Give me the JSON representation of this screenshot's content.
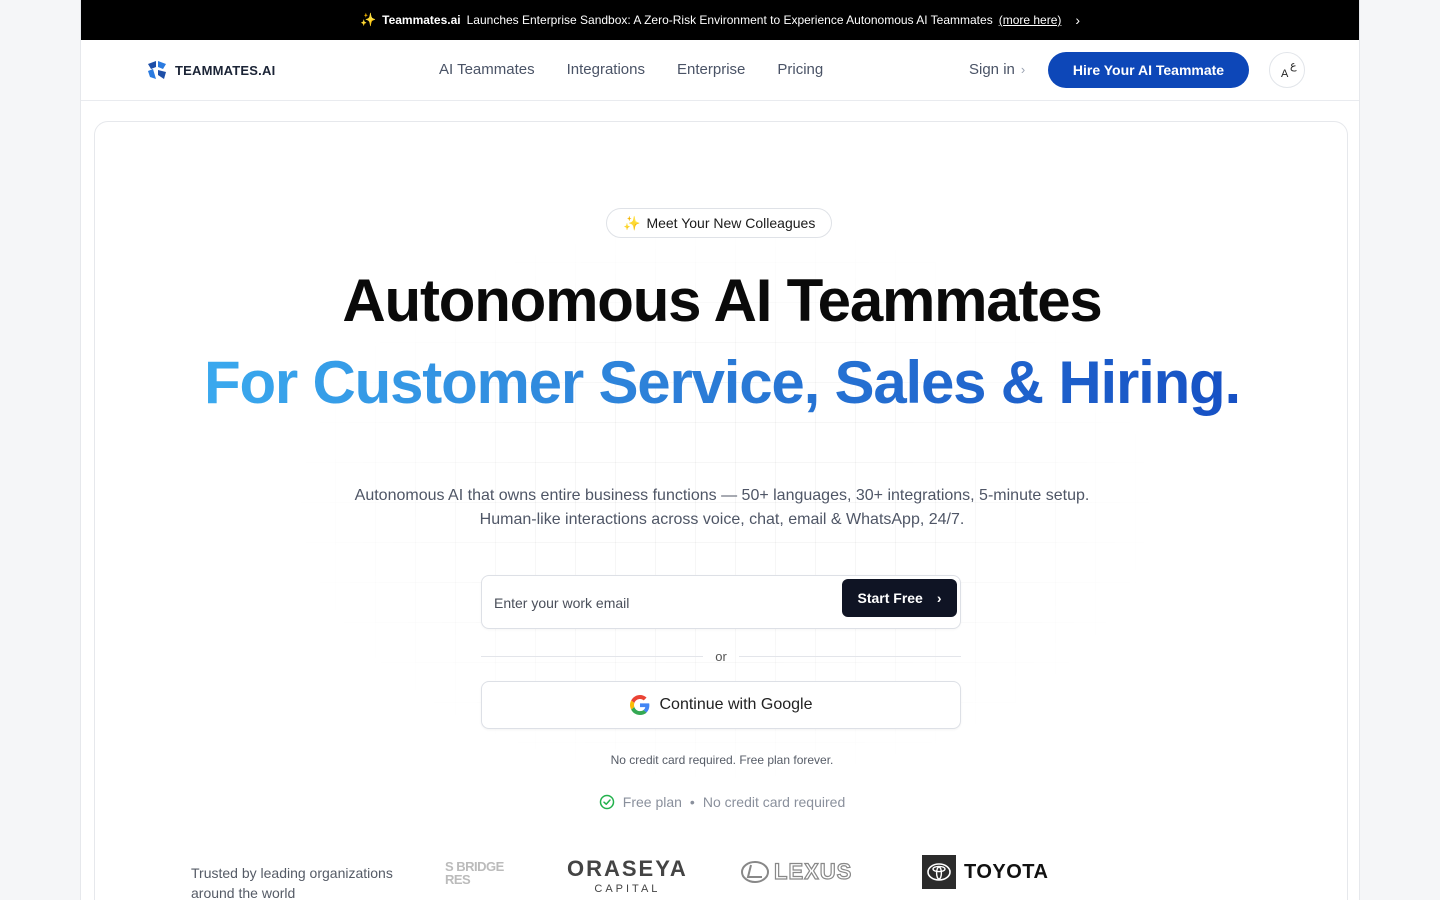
{
  "announcement": {
    "brand": "Teammates.ai",
    "text": "Launches Enterprise Sandbox: A Zero-Risk Environment to Experience Autonomous AI Teammates",
    "link": "(more here)"
  },
  "nav": {
    "logo_text": "TEAMMATES.AI",
    "links": [
      "AI Teammates",
      "Integrations",
      "Enterprise",
      "Pricing"
    ],
    "signin": "Sign in",
    "cta": "Hire Your AI Teammate",
    "lang_a": "A",
    "lang_ar": "ع"
  },
  "hero": {
    "badge": "Meet Your New Colleagues",
    "title": "Autonomous AI Teammates",
    "subtitle": "For Customer Service, Sales & Hiring.",
    "desc_line1": "Autonomous AI that owns entire business functions — 50+ languages, 30+ integrations, 5-minute setup.",
    "desc_line2": "Human-like interactions across voice, chat, email & WhatsApp, 24/7.",
    "email_placeholder": "Enter your work email",
    "start_button": "Start Free",
    "or": "or",
    "google_button": "Continue with Google",
    "note": "No credit card required. Free plan forever.",
    "free_plan": "Free plan",
    "no_card": "No credit card required",
    "separator": "•"
  },
  "trusted": {
    "label": "Trusted by leading organizations around the world",
    "logos": {
      "bridge": "S BRIDGE RES",
      "raseya_big": "ORASEYA",
      "raseya_small": "CAPITAL",
      "lexus": "LEXUS",
      "toyota": "TOYOTA"
    }
  },
  "colors": {
    "cta_blue": "#0d47b8",
    "gradient_start": "#3aa9ee",
    "gradient_end": "#1650c4",
    "dark_button": "#0f1424",
    "check_green": "#22b14c"
  }
}
